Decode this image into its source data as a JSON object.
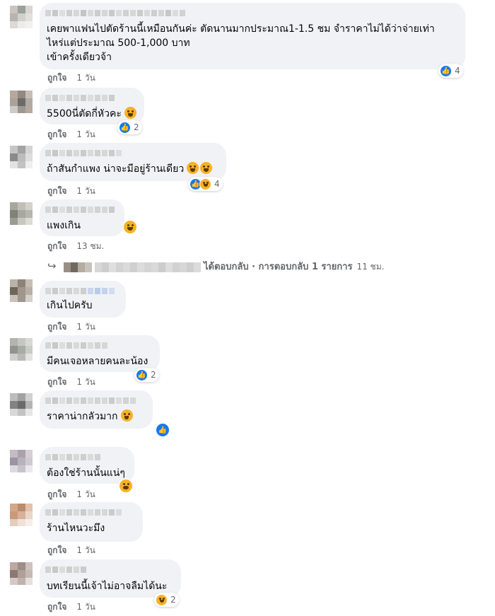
{
  "labels": {
    "like": "ถูกใจ"
  },
  "comments": [
    {
      "lines": [
        "เคยพาแฟนไปตัดร้านนี้เหมือนกันค่ะ ตัดนานมากประมาณ1-1.5 ชม จำราคาไม่ได้ว่าจ่ายเท่า",
        "ไหร่แต่ประมาณ 500-1,000 บาท",
        "เข้าครั้งเดียวจ้า"
      ],
      "time": "1 วัน",
      "reactions": [
        "like-icon"
      ],
      "reaction_count": "4"
    },
    {
      "lines": [
        "5500นี่ตัดกี่หัวคะ"
      ],
      "inline_emoji": "tears-emoji",
      "time": "1 วัน",
      "reactions": [
        "like-icon"
      ],
      "reaction_count": "2"
    },
    {
      "lines": [
        "ถ้าสันกำแพง น่าจะมีอยู่ร้านเดียว"
      ],
      "inline_emoji": "laughing-tears-emoji x2",
      "time": "1 วัน",
      "reactions": [
        "like-icon",
        "haha-icon"
      ],
      "reaction_count": "4"
    },
    {
      "lines": [
        "แพงเกิน"
      ],
      "time": "13 ชม.",
      "reactions": [
        "haha-icon"
      ],
      "reaction_count": ""
    },
    {
      "lines": [
        "เกินไปครับ"
      ],
      "time": "1 วัน",
      "reactions": [],
      "reaction_count": ""
    },
    {
      "lines": [
        "มีคนเจอหลายคนละน้อง"
      ],
      "time": "1 วัน",
      "reactions": [
        "like-icon"
      ],
      "reaction_count": "2"
    },
    {
      "lines": [
        "ราคาน่ากลัวมาก"
      ],
      "inline_emoji": "grin-emoji",
      "time": "1 วัน",
      "reactions": [
        "like-icon"
      ],
      "reaction_count": ""
    },
    {
      "lines": [
        "ต้องใช่ร้านนั้นแน่ๆ"
      ],
      "time": "1 วัน",
      "reactions": [
        "wow-icon"
      ],
      "reaction_count": ""
    },
    {
      "lines": [
        "ร้านไหนวะมึง"
      ],
      "time": "1 วัน",
      "reactions": [],
      "reaction_count": ""
    },
    {
      "lines": [
        "บทเรียนนี้เจ้าไม่อาจลืมได้นะ"
      ],
      "time": "1 วัน",
      "reactions": [
        "haha-icon"
      ],
      "reaction_count": "2"
    }
  ],
  "reply": {
    "text": "ได้ตอบกลับ · การตอบกลับ 1 รายการ",
    "time": "11 ชม."
  },
  "colors": {
    "bubble": "#f0f2f5",
    "like_blue": "#1877f2",
    "emoji_yellow": "#f7b125",
    "meta_gray": "#65676b"
  }
}
